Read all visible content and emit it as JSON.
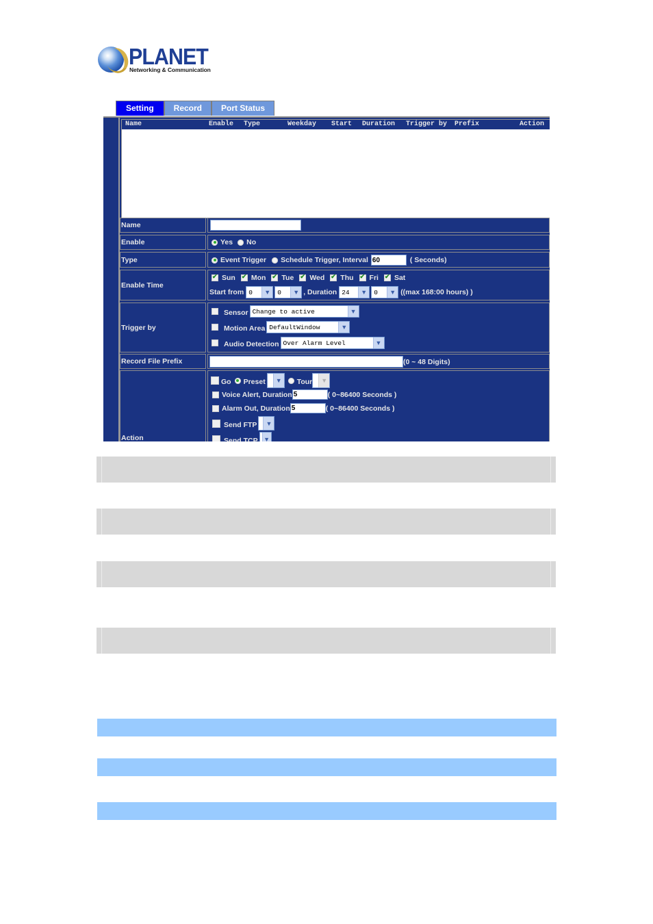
{
  "brand": {
    "name": "PLANET",
    "tagline": "Networking & Communication"
  },
  "tabs": [
    {
      "label": "Setting",
      "active": true
    },
    {
      "label": "Record",
      "active": false
    },
    {
      "label": "Port Status",
      "active": false
    }
  ],
  "event_list": {
    "columns": [
      "Name",
      "Enable",
      "Type",
      "Weekday",
      "Start",
      "Duration",
      "Trigger by",
      "Prefix",
      "Action"
    ],
    "rows": []
  },
  "form": {
    "name": {
      "label": "Name",
      "value": ""
    },
    "enable": {
      "label": "Enable",
      "options": [
        "Yes",
        "No"
      ],
      "selected": "Yes"
    },
    "type": {
      "label": "Type",
      "event_trigger": "Event Trigger",
      "schedule_trigger": "Schedule Trigger, Interval",
      "selected": "Event Trigger",
      "interval": "60",
      "unit": "( Seconds)"
    },
    "enable_time": {
      "label": "Enable Time",
      "days": [
        {
          "label": "Sun",
          "checked": true
        },
        {
          "label": "Mon",
          "checked": true
        },
        {
          "label": "Tue",
          "checked": true
        },
        {
          "label": "Wed",
          "checked": true
        },
        {
          "label": "Thu",
          "checked": true
        },
        {
          "label": "Fri",
          "checked": true
        },
        {
          "label": "Sat",
          "checked": true
        }
      ],
      "start_from_label": "Start from",
      "start_hour": "0",
      "start_min": "0",
      "duration_label": ", Duration",
      "duration_hour": "24",
      "duration_min": "0",
      "max_note": "((max 168:00 hours) )"
    },
    "trigger_by": {
      "label": "Trigger by",
      "sensor": {
        "label": "Sensor",
        "checked": false,
        "value": "Change to active"
      },
      "motion": {
        "label": "Motion Area",
        "checked": false,
        "value": "DefaultWindow"
      },
      "audio": {
        "label": "Audio Detection",
        "checked": false,
        "value": "Over Alarm Level"
      }
    },
    "prefix": {
      "label": "Record File Prefix",
      "value": "",
      "note": "(0 ~ 48 Digits)"
    },
    "action": {
      "label": "Action",
      "go": {
        "label": "Go",
        "checked": false
      },
      "preset": {
        "label": "Preset",
        "selected": true,
        "value": ""
      },
      "tour": {
        "label": "Tour",
        "selected": false,
        "value": ""
      },
      "voice_alert": {
        "label": "Voice Alert, Duration",
        "checked": false,
        "value": "5",
        "note": "( 0~86400 Seconds )"
      },
      "alarm_out": {
        "label": "Alarm Out, Duration",
        "checked": false,
        "value": "5",
        "note": "( 0~86400 Seconds )"
      },
      "send_ftp": {
        "label": "Send FTP",
        "checked": false,
        "value": ""
      },
      "send_tcp": {
        "label": "Send TCP",
        "checked": false,
        "value": ""
      }
    }
  },
  "colors": {
    "panel_bg": "#1a3382",
    "active_tab": "#0000f0",
    "inactive_tab": "#6f98dc",
    "gray_bar": "#d8d8d8",
    "blue_bar": "#99cbff"
  }
}
